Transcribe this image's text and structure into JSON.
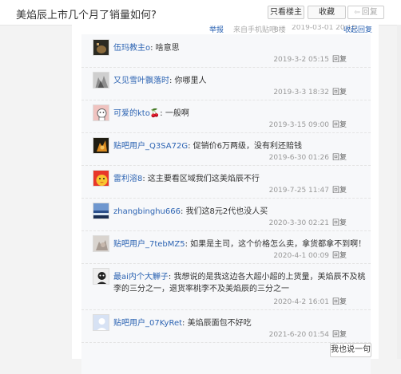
{
  "header": {
    "title": "美焰辰上市几个月了销量如何?",
    "only_op": "只看楼主",
    "favorite": "收藏",
    "reply": "回复"
  },
  "floor_meta": {
    "report": "举报",
    "source": "来自手机贴吧",
    "floor": "8楼",
    "date": "2019-03-01 20:16",
    "collapse": "收起回复"
  },
  "comments": [
    {
      "user": "伍玛教主o",
      "text": ": 啥意思",
      "time": "2019-3-2 05:15",
      "reply": "回复"
    },
    {
      "user": "又见雪叶飘落时",
      "text": ": 你哪里人",
      "time": "2019-3-3 18:32",
      "reply": "回复"
    },
    {
      "user": "可爱的kto",
      "text": ": 一般啊",
      "time": "2019-3-15 09:00",
      "reply": "回复"
    },
    {
      "user": "贴吧用户_Q3SA72G",
      "text": ": 促销价6万两级，没有利还赔钱",
      "time": "2019-6-30 01:26",
      "reply": "回复"
    },
    {
      "user": "雷利溶8",
      "text": ": 这主要看区域我们这美焰辰不行",
      "time": "2019-7-25 11:47",
      "reply": "回复"
    },
    {
      "user": "zhangbinghu666",
      "text": ": 我们这8元2代也没人买",
      "time": "2020-3-30 02:21",
      "reply": "回复"
    },
    {
      "user": "贴吧用户_7tebMZ5",
      "text": ": 如果是主司，这个价格怎么卖，拿货都拿不到啊！",
      "time": "2020-4-1 00:09",
      "reply": "回复"
    },
    {
      "user": "最ai内个大觯子",
      "text": ": 我想说的是我这边各大超小超的上货量，美焰辰不及桃李的三分之一，退货率桃李不及美焰辰的三分之一",
      "time": "2020-4-2 16:01",
      "reply": "回复"
    },
    {
      "user": "贴吧用户_07KyRet",
      "text": ": 美焰辰面包不好吃",
      "time": "2021-6-20 01:54",
      "reply": "回复"
    }
  ],
  "say_button": "我也说一句"
}
